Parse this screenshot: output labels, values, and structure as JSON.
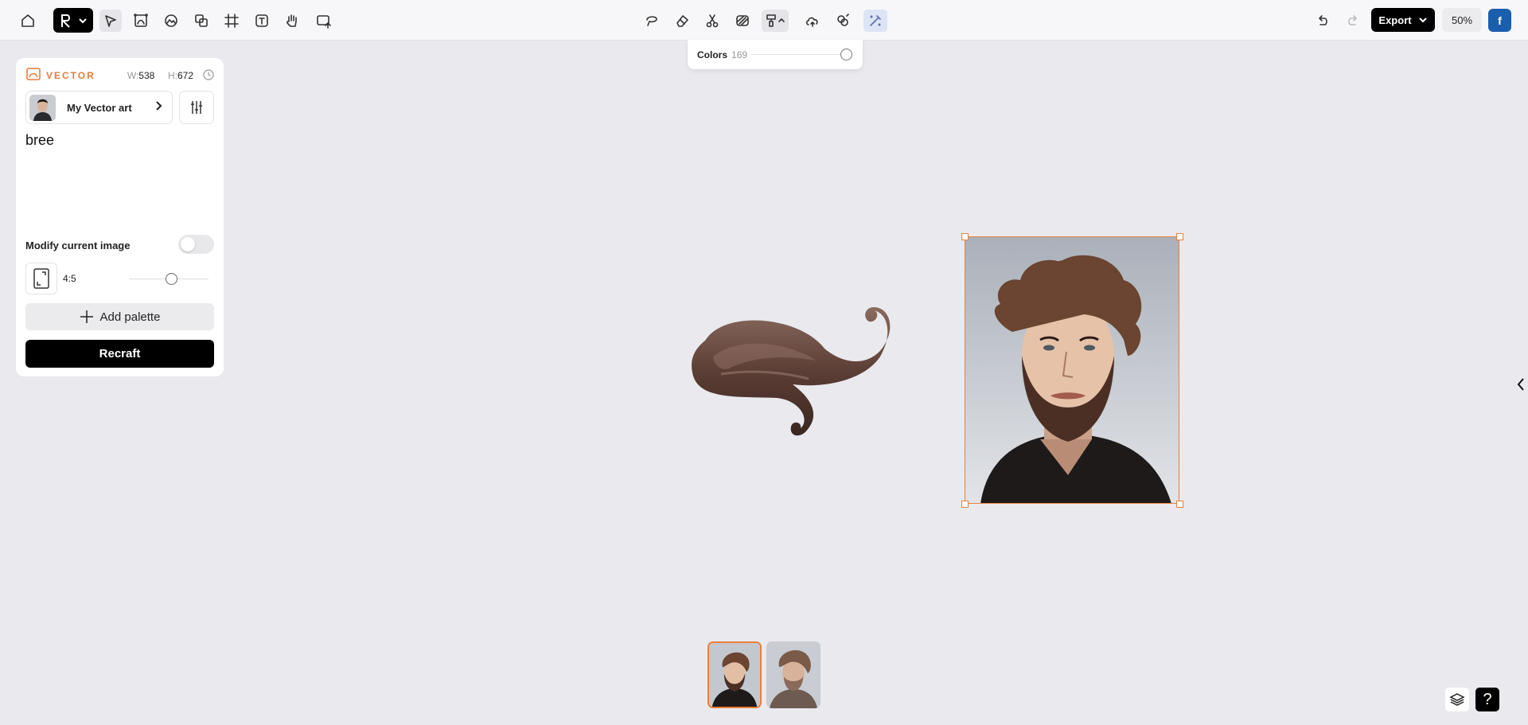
{
  "toolbar": {
    "left_tools": [
      "home-icon",
      "brand-logo",
      "select-icon",
      "vectorize-icon",
      "generate-icon",
      "mockup-icon",
      "frame-icon",
      "text-icon",
      "hand-icon",
      "upload-icon"
    ],
    "center_tools": [
      "lasso-icon",
      "eraser-icon",
      "scissors-icon",
      "remove-background-icon",
      "colors-palette-icon",
      "upscale-icon",
      "similar-icon",
      "magic-icon"
    ],
    "export_label": "Export",
    "zoom_label": "50%",
    "account_initial": "f"
  },
  "colors_popover": {
    "label": "Colors",
    "count": "169",
    "slider_fraction": 0.97
  },
  "panel": {
    "mode_label": "VECTOR",
    "width_key": "W:",
    "width_value": "538",
    "height_key": "H:",
    "height_value": "672",
    "style_name": "My Vector art",
    "prompt": "bree",
    "modify_label": "Modify current image",
    "modify_enabled": false,
    "ratio_label": "4:5",
    "ratio_slider_fraction": 0.55,
    "add_palette_label": "Add palette",
    "recraft_label": "Recraft"
  },
  "canvas": {
    "items": [
      "swirl-vector-art",
      "bearded-man-portrait"
    ],
    "selected": "bearded-man-portrait"
  },
  "thumbnails": {
    "count": 2,
    "selected_index": 0
  },
  "colors": {
    "accent": "#e8803d",
    "background": "#e9e9ee",
    "account": "#1a5fae"
  }
}
